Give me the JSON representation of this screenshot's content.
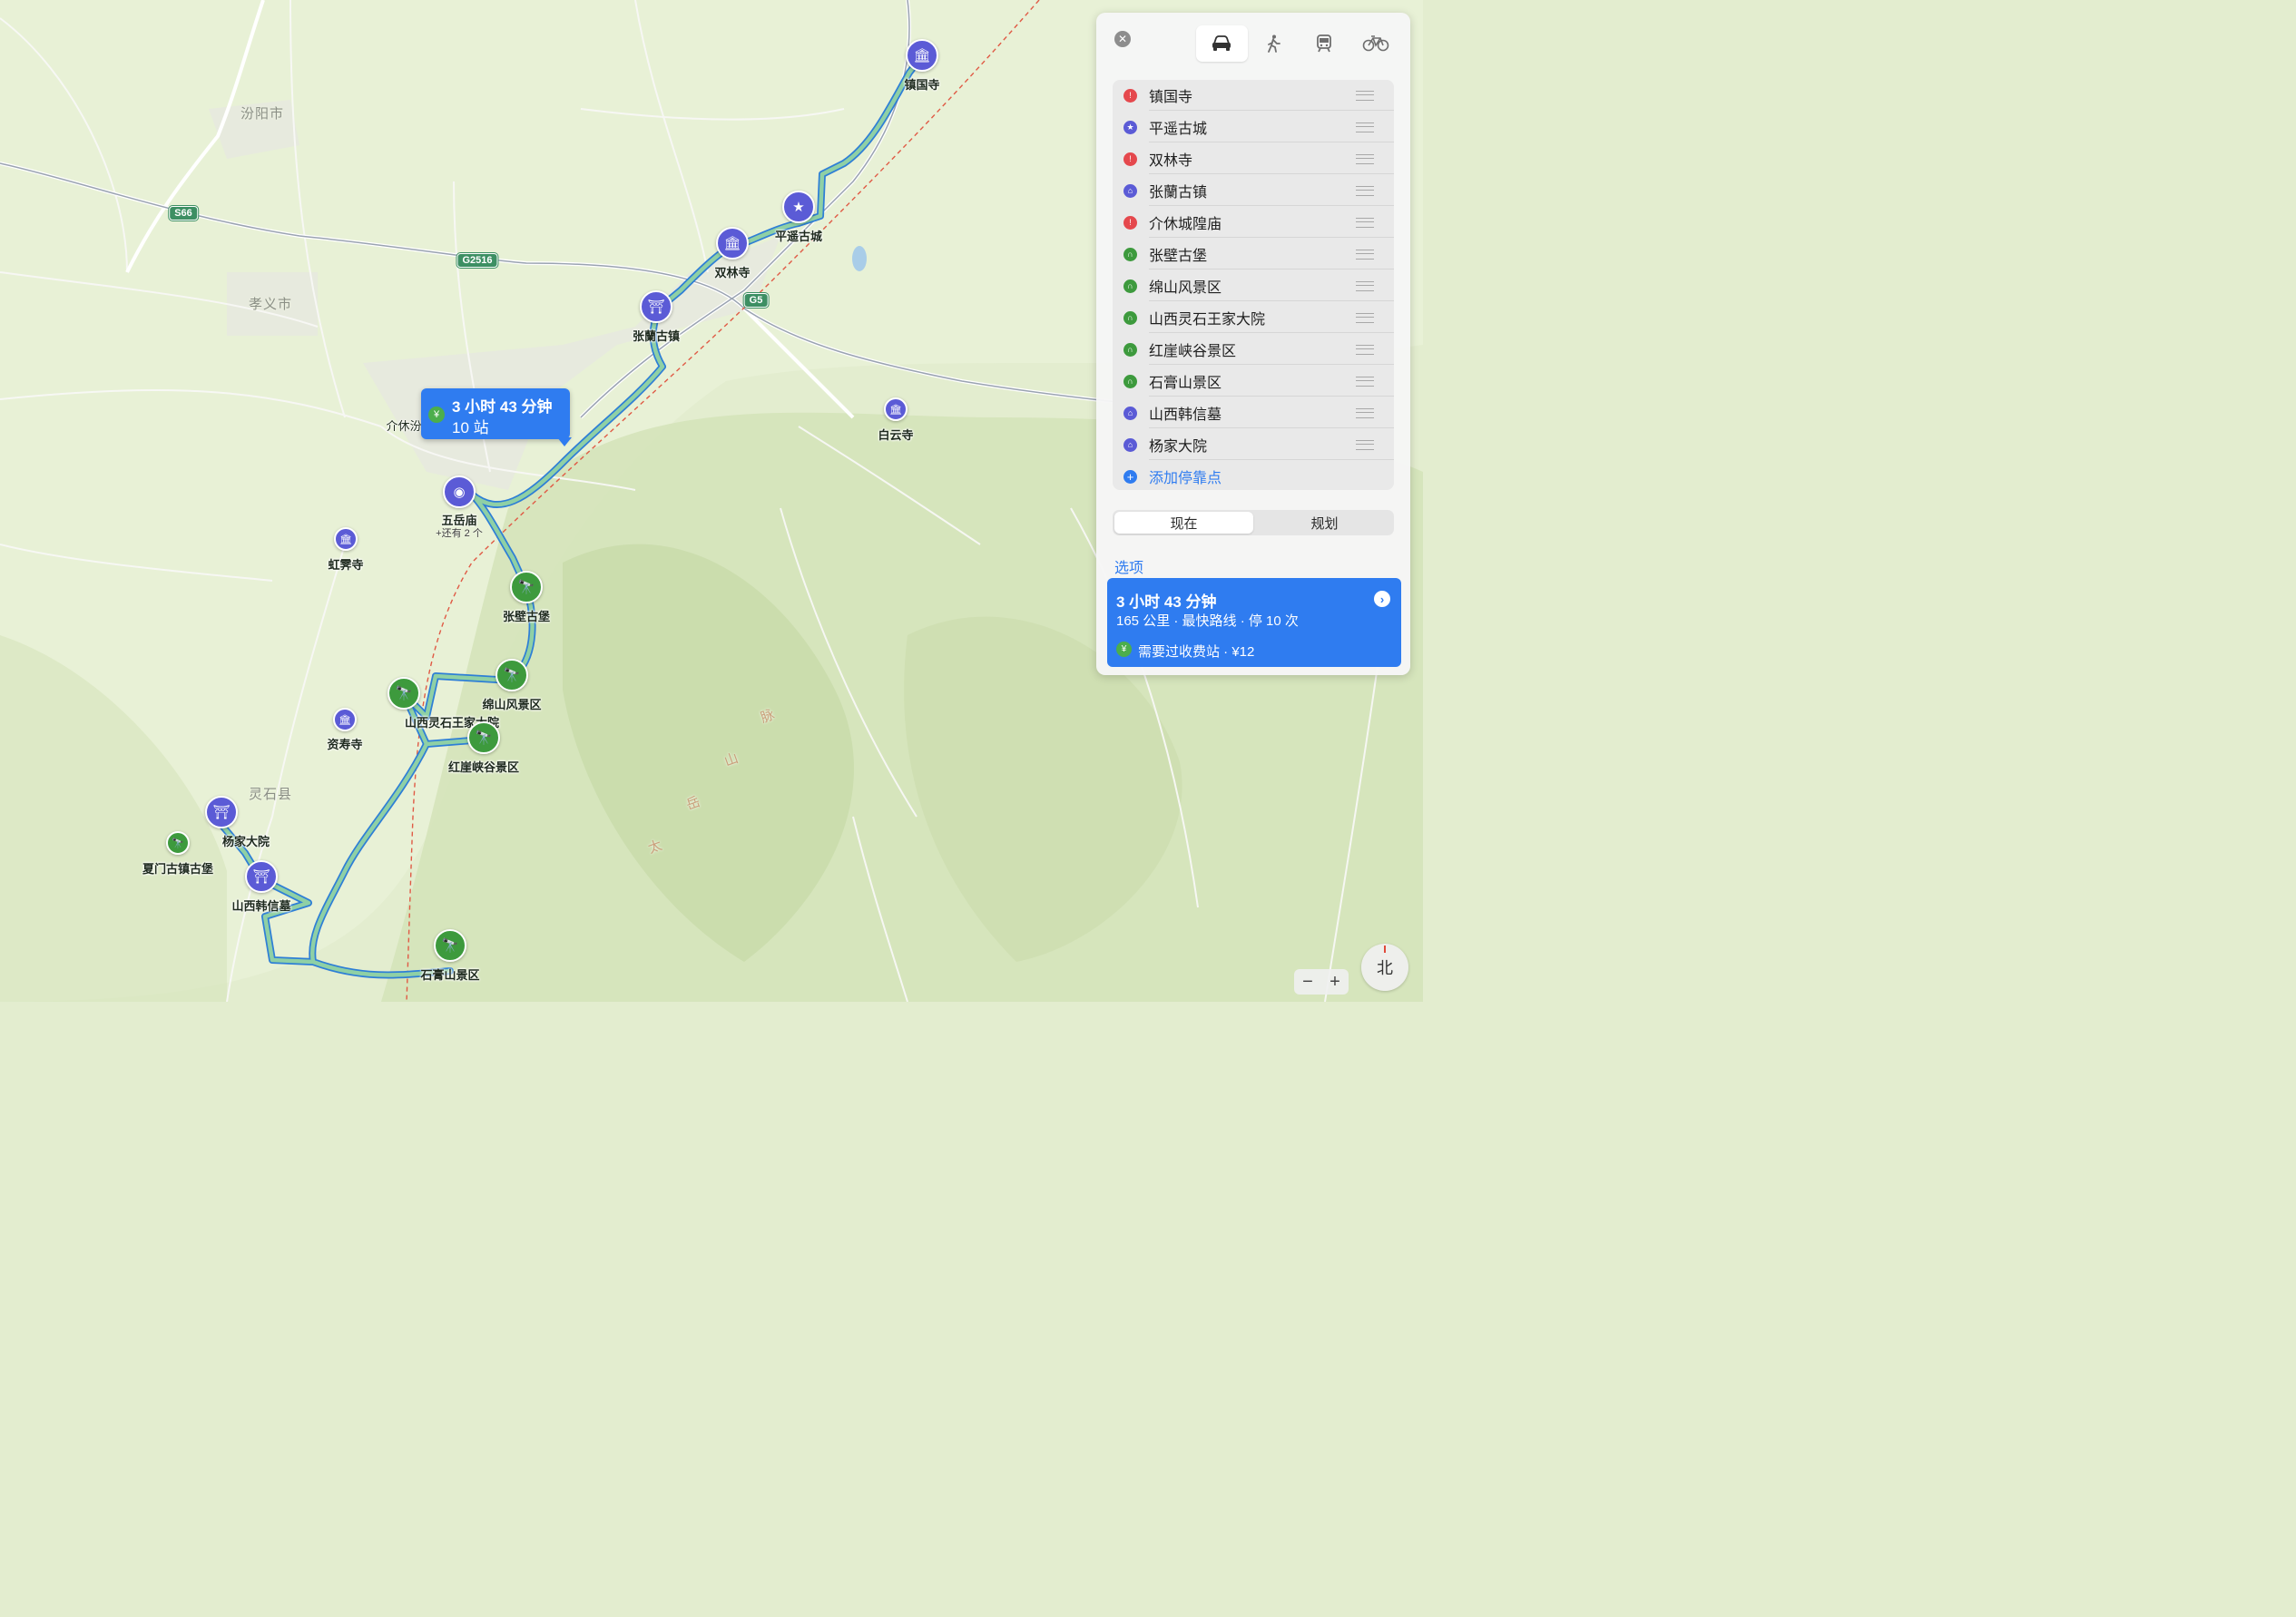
{
  "map": {
    "cities": [
      "汾阳市",
      "孝义市",
      "灵石县"
    ],
    "partial_city": "介休汾",
    "highways": [
      "S66",
      "G2516",
      "G5"
    ],
    "terrain_text": [
      "太",
      "岳",
      "山",
      "脉"
    ],
    "places": {
      "zhenguosi": "镇国寺",
      "pingyao": "平遥古城",
      "shuanglinsi": "双林寺",
      "zhanglan": "张蘭古镇",
      "baiyunsi": "白云寺",
      "wuyuemiao": "五岳庙",
      "wuyuemiao_more": "+还有 2 个",
      "hongjisi": "虹霁寺",
      "zhangbi": "张壁古堡",
      "mianshan": "绵山风景区",
      "wangjia": "山西灵石王家大院",
      "ziseosi": "资寿寺",
      "hongya": "红崖峡谷景区",
      "yangjia": "杨家大院",
      "xiamen": "夏门古镇古堡",
      "hanxin": "山西韩信墓",
      "shigao": "石膏山景区"
    },
    "bubble": {
      "icon": "yen-icon",
      "duration": "3 小时 43 分钟",
      "stops": "10 站"
    },
    "colors": {
      "route": "#77c29b",
      "route_border": "#2e7fd6",
      "pin_purple": "#5b5bd6",
      "pin_green": "#3d9a3d",
      "accent": "#2f7cf0"
    }
  },
  "panel": {
    "close_icon": "close-icon",
    "modes": [
      {
        "id": "drive",
        "icon": "car-icon",
        "active": true
      },
      {
        "id": "walk",
        "icon": "walk-icon",
        "active": false
      },
      {
        "id": "transit",
        "icon": "train-icon",
        "active": false
      },
      {
        "id": "bike",
        "icon": "bike-icon",
        "active": false
      }
    ],
    "stops": [
      {
        "name": "镇国寺",
        "icon": "pin-icon",
        "color": "#e5484d"
      },
      {
        "name": "平遥古城",
        "icon": "star-icon",
        "color": "#5b5bd6"
      },
      {
        "name": "双林寺",
        "icon": "pin-icon",
        "color": "#e5484d"
      },
      {
        "name": "张蘭古镇",
        "icon": "landmark-icon",
        "color": "#5b5bd6"
      },
      {
        "name": "介休城隍庙",
        "icon": "pin-icon",
        "color": "#e5484d"
      },
      {
        "name": "张壁古堡",
        "icon": "binoculars-icon",
        "color": "#3d9a3d"
      },
      {
        "name": "绵山风景区",
        "icon": "binoculars-icon",
        "color": "#3d9a3d"
      },
      {
        "name": "山西灵石王家大院",
        "icon": "binoculars-icon",
        "color": "#3d9a3d"
      },
      {
        "name": "红崖峡谷景区",
        "icon": "binoculars-icon",
        "color": "#3d9a3d"
      },
      {
        "name": "石膏山景区",
        "icon": "binoculars-icon",
        "color": "#3d9a3d"
      },
      {
        "name": "山西韩信墓",
        "icon": "landmark-icon",
        "color": "#5b5bd6"
      },
      {
        "name": "杨家大院",
        "icon": "landmark-icon",
        "color": "#5b5bd6"
      }
    ],
    "add_stop": "添加停靠点",
    "time_tabs": {
      "now": "现在",
      "plan": "规划",
      "selected": "now"
    },
    "options_label": "选项",
    "route": {
      "duration": "3 小时 43 分钟",
      "details": "165 公里 · 最快路线 · 停 10 次",
      "toll": "需要过收费站 · ¥12"
    }
  },
  "controls": {
    "zoom_out": "−",
    "zoom_in": "+",
    "compass": "北"
  }
}
